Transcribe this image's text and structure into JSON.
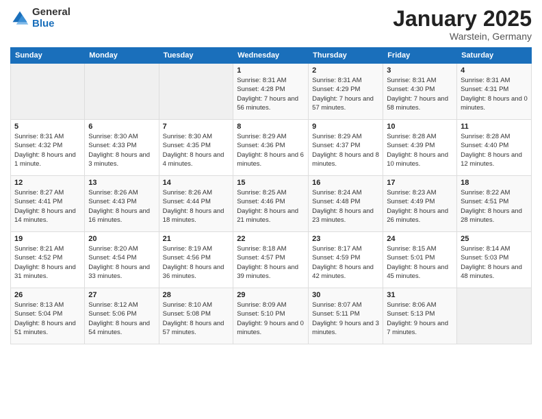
{
  "logo": {
    "general": "General",
    "blue": "Blue"
  },
  "header": {
    "month": "January 2025",
    "location": "Warstein, Germany"
  },
  "days_of_week": [
    "Sunday",
    "Monday",
    "Tuesday",
    "Wednesday",
    "Thursday",
    "Friday",
    "Saturday"
  ],
  "weeks": [
    [
      {
        "day": "",
        "info": ""
      },
      {
        "day": "",
        "info": ""
      },
      {
        "day": "",
        "info": ""
      },
      {
        "day": "1",
        "info": "Sunrise: 8:31 AM\nSunset: 4:28 PM\nDaylight: 7 hours and 56 minutes."
      },
      {
        "day": "2",
        "info": "Sunrise: 8:31 AM\nSunset: 4:29 PM\nDaylight: 7 hours and 57 minutes."
      },
      {
        "day": "3",
        "info": "Sunrise: 8:31 AM\nSunset: 4:30 PM\nDaylight: 7 hours and 58 minutes."
      },
      {
        "day": "4",
        "info": "Sunrise: 8:31 AM\nSunset: 4:31 PM\nDaylight: 8 hours and 0 minutes."
      }
    ],
    [
      {
        "day": "5",
        "info": "Sunrise: 8:31 AM\nSunset: 4:32 PM\nDaylight: 8 hours and 1 minute."
      },
      {
        "day": "6",
        "info": "Sunrise: 8:30 AM\nSunset: 4:33 PM\nDaylight: 8 hours and 3 minutes."
      },
      {
        "day": "7",
        "info": "Sunrise: 8:30 AM\nSunset: 4:35 PM\nDaylight: 8 hours and 4 minutes."
      },
      {
        "day": "8",
        "info": "Sunrise: 8:29 AM\nSunset: 4:36 PM\nDaylight: 8 hours and 6 minutes."
      },
      {
        "day": "9",
        "info": "Sunrise: 8:29 AM\nSunset: 4:37 PM\nDaylight: 8 hours and 8 minutes."
      },
      {
        "day": "10",
        "info": "Sunrise: 8:28 AM\nSunset: 4:39 PM\nDaylight: 8 hours and 10 minutes."
      },
      {
        "day": "11",
        "info": "Sunrise: 8:28 AM\nSunset: 4:40 PM\nDaylight: 8 hours and 12 minutes."
      }
    ],
    [
      {
        "day": "12",
        "info": "Sunrise: 8:27 AM\nSunset: 4:41 PM\nDaylight: 8 hours and 14 minutes."
      },
      {
        "day": "13",
        "info": "Sunrise: 8:26 AM\nSunset: 4:43 PM\nDaylight: 8 hours and 16 minutes."
      },
      {
        "day": "14",
        "info": "Sunrise: 8:26 AM\nSunset: 4:44 PM\nDaylight: 8 hours and 18 minutes."
      },
      {
        "day": "15",
        "info": "Sunrise: 8:25 AM\nSunset: 4:46 PM\nDaylight: 8 hours and 21 minutes."
      },
      {
        "day": "16",
        "info": "Sunrise: 8:24 AM\nSunset: 4:48 PM\nDaylight: 8 hours and 23 minutes."
      },
      {
        "day": "17",
        "info": "Sunrise: 8:23 AM\nSunset: 4:49 PM\nDaylight: 8 hours and 26 minutes."
      },
      {
        "day": "18",
        "info": "Sunrise: 8:22 AM\nSunset: 4:51 PM\nDaylight: 8 hours and 28 minutes."
      }
    ],
    [
      {
        "day": "19",
        "info": "Sunrise: 8:21 AM\nSunset: 4:52 PM\nDaylight: 8 hours and 31 minutes."
      },
      {
        "day": "20",
        "info": "Sunrise: 8:20 AM\nSunset: 4:54 PM\nDaylight: 8 hours and 33 minutes."
      },
      {
        "day": "21",
        "info": "Sunrise: 8:19 AM\nSunset: 4:56 PM\nDaylight: 8 hours and 36 minutes."
      },
      {
        "day": "22",
        "info": "Sunrise: 8:18 AM\nSunset: 4:57 PM\nDaylight: 8 hours and 39 minutes."
      },
      {
        "day": "23",
        "info": "Sunrise: 8:17 AM\nSunset: 4:59 PM\nDaylight: 8 hours and 42 minutes."
      },
      {
        "day": "24",
        "info": "Sunrise: 8:15 AM\nSunset: 5:01 PM\nDaylight: 8 hours and 45 minutes."
      },
      {
        "day": "25",
        "info": "Sunrise: 8:14 AM\nSunset: 5:03 PM\nDaylight: 8 hours and 48 minutes."
      }
    ],
    [
      {
        "day": "26",
        "info": "Sunrise: 8:13 AM\nSunset: 5:04 PM\nDaylight: 8 hours and 51 minutes."
      },
      {
        "day": "27",
        "info": "Sunrise: 8:12 AM\nSunset: 5:06 PM\nDaylight: 8 hours and 54 minutes."
      },
      {
        "day": "28",
        "info": "Sunrise: 8:10 AM\nSunset: 5:08 PM\nDaylight: 8 hours and 57 minutes."
      },
      {
        "day": "29",
        "info": "Sunrise: 8:09 AM\nSunset: 5:10 PM\nDaylight: 9 hours and 0 minutes."
      },
      {
        "day": "30",
        "info": "Sunrise: 8:07 AM\nSunset: 5:11 PM\nDaylight: 9 hours and 3 minutes."
      },
      {
        "day": "31",
        "info": "Sunrise: 8:06 AM\nSunset: 5:13 PM\nDaylight: 9 hours and 7 minutes."
      },
      {
        "day": "",
        "info": ""
      }
    ]
  ]
}
